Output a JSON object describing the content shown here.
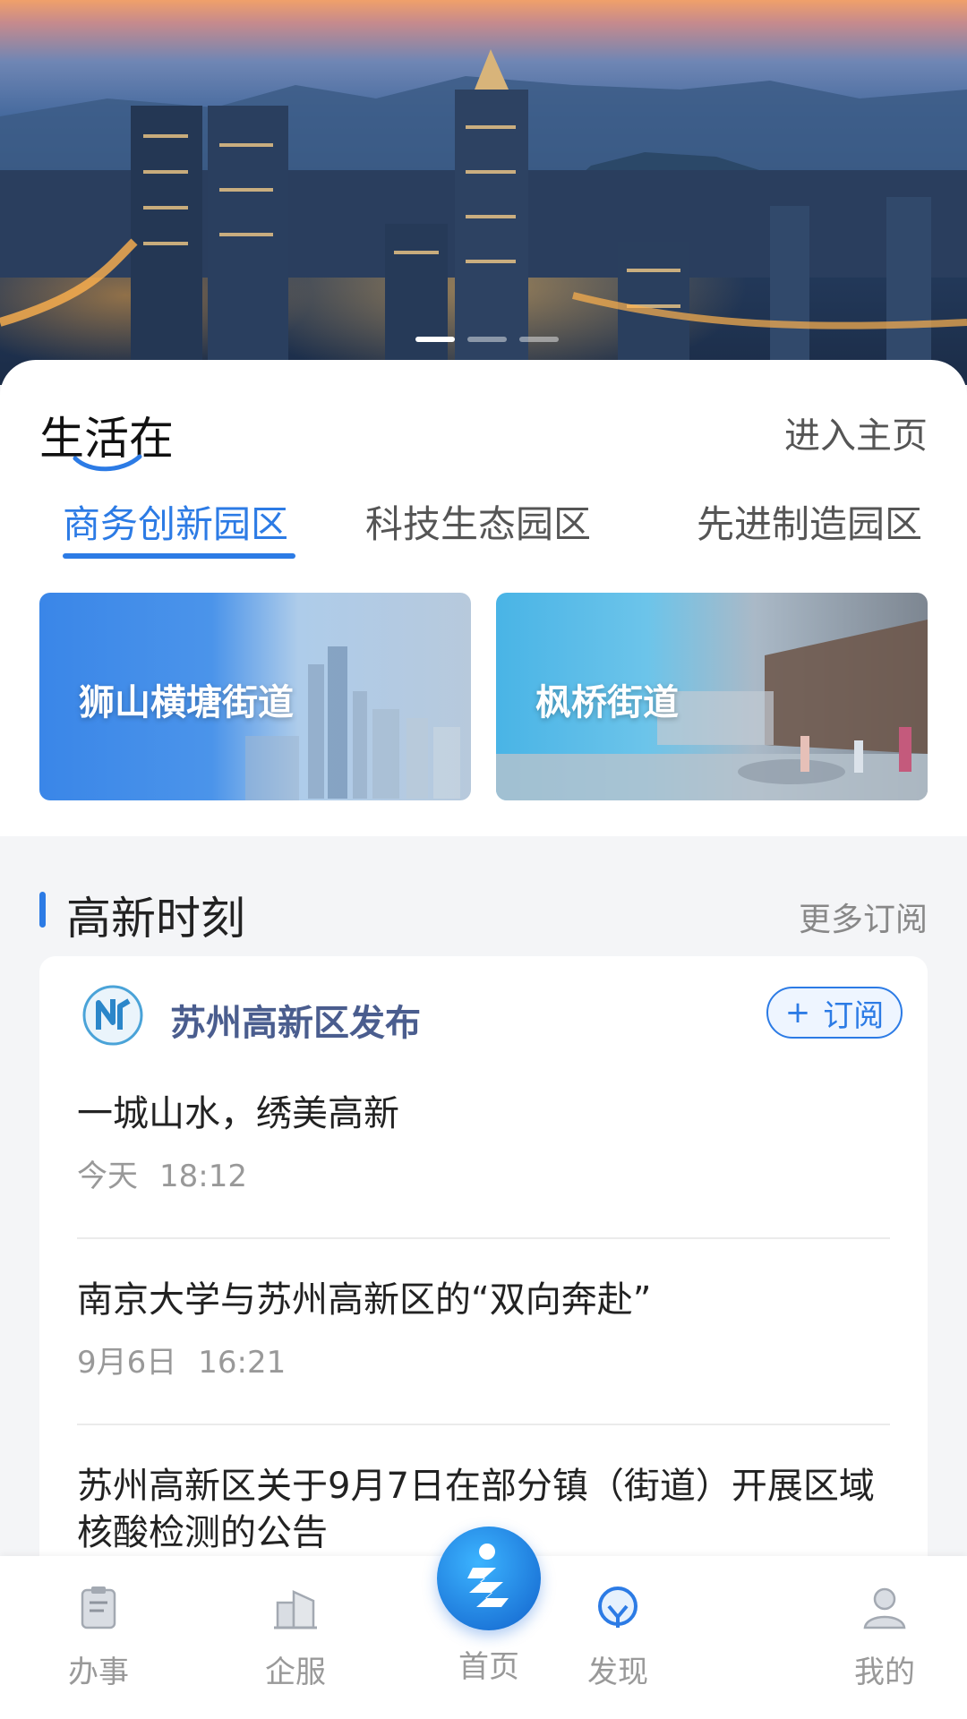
{
  "hero": {
    "slides": 3,
    "active_slide": 0
  },
  "life": {
    "title": "生活在",
    "enter_home": "进入主页",
    "tabs": [
      "商务创新园区",
      "科技生态园区",
      "先进制造园区"
    ],
    "districts": [
      "狮山横塘街道",
      "枫桥街道"
    ]
  },
  "news": {
    "title": "高新时刻",
    "more": "更多订阅",
    "publisher": "苏州高新区发布",
    "subscribe": "订阅",
    "articles": [
      {
        "headline": "一城山水，绣美高新",
        "date": "今天",
        "time": "18:12"
      },
      {
        "headline": "南京大学与苏州高新区的“双向奔赴”",
        "date": "9月6日",
        "time": "16:21"
      },
      {
        "headline": "苏州高新区关于9月7日在部分镇（街道）开展区域核酸检测的公告",
        "date": "",
        "time": ""
      }
    ]
  },
  "nav": {
    "items": [
      "办事",
      "企服",
      "首页",
      "发现",
      "我的"
    ],
    "active": "发现"
  },
  "colors": {
    "accent": "#2c7be5",
    "publisher": "#4a5d8e"
  }
}
